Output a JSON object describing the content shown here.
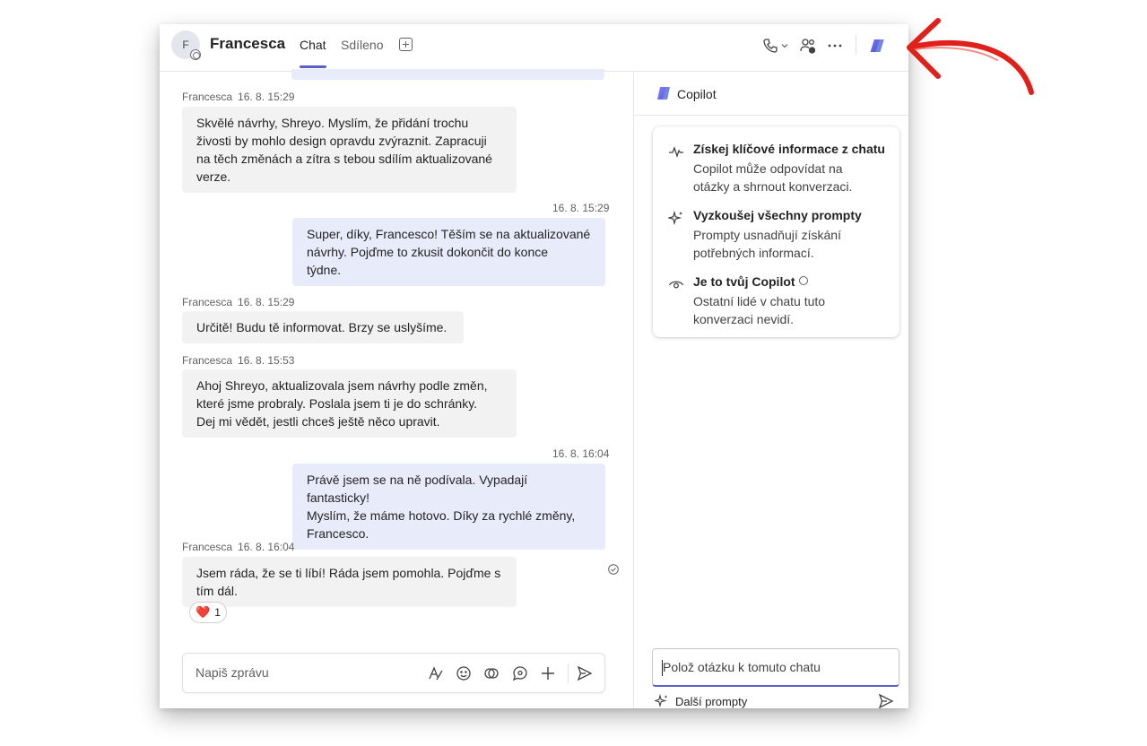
{
  "header": {
    "avatar_initial": "F",
    "contact_name": "Francesca",
    "tabs": [
      {
        "label": "Chat"
      },
      {
        "label": "Sdíleno"
      }
    ]
  },
  "messages": [
    {
      "direction": "in",
      "sender": "Francesca",
      "time": "16. 8. 15:29",
      "text": "Skvělé návrhy, Shreyo. Myslím, že přidání trochu\nživosti by mohlo design opravdu zvýraznit. Zapracuji\nna těch změnách a zítra s tebou sdílím aktualizované\nverze."
    },
    {
      "direction": "out",
      "time": "16. 8. 15:29",
      "text": "Super, díky, Francesco! Těším se na aktualizované\nnávrhy. Pojďme to zkusit dokončit do konce\ntýdne."
    },
    {
      "direction": "in",
      "sender": "Francesca",
      "time": "16. 8. 15:29",
      "text": "Určitě! Budu tě informovat. Brzy se uslyšíme."
    },
    {
      "direction": "in",
      "sender": "Francesca",
      "time": "16. 8. 15:53",
      "text": "Ahoj Shreyo, aktualizovala jsem návrhy podle změn,\nkteré jsme probraly. Poslala jsem ti je do schránky.\nDej mi vědět, jestli chceš ještě něco upravit."
    },
    {
      "direction": "out",
      "time": "16. 8. 16:04",
      "text": "Právě jsem se na ně podívala. Vypadají fantasticky!\nMyslím, že máme hotovo. Díky za rychlé změny,\nFrancesco."
    },
    {
      "direction": "in",
      "sender": "Francesca",
      "time": "16. 8. 16:04",
      "text": "Jsem ráda, že se ti líbí! Ráda jsem pomohla. Pojďme s\ntím dál."
    }
  ],
  "reaction": {
    "emoji": "❤️",
    "count": "1"
  },
  "composer": {
    "placeholder": "Napiš zprávu"
  },
  "copilot": {
    "title": "Copilot",
    "items": [
      {
        "icon": "pulse-icon",
        "title": "Získej klíčové informace z chatu",
        "desc": "Copilot může odpovídat na\notázky a shrnout konverzaci."
      },
      {
        "icon": "sparkle-icon",
        "title": "Vyzkoušej všechny prompty",
        "desc": "Prompty usnadňují získání\npotřebných informací."
      },
      {
        "icon": "eye-icon",
        "title": "Je to tvůj Copilot",
        "desc": "Ostatní lidé v chatu tuto\nkonverzaci nevidí."
      }
    ],
    "input_placeholder": "Polož otázku k tomuto chatu",
    "more_prompts": "Další prompty"
  },
  "colors": {
    "accent": "#5b5fc7",
    "outgoing_bubble": "#e8ebfa",
    "incoming_bubble": "#f2f2f2",
    "annotation_arrow": "#e0201b"
  }
}
